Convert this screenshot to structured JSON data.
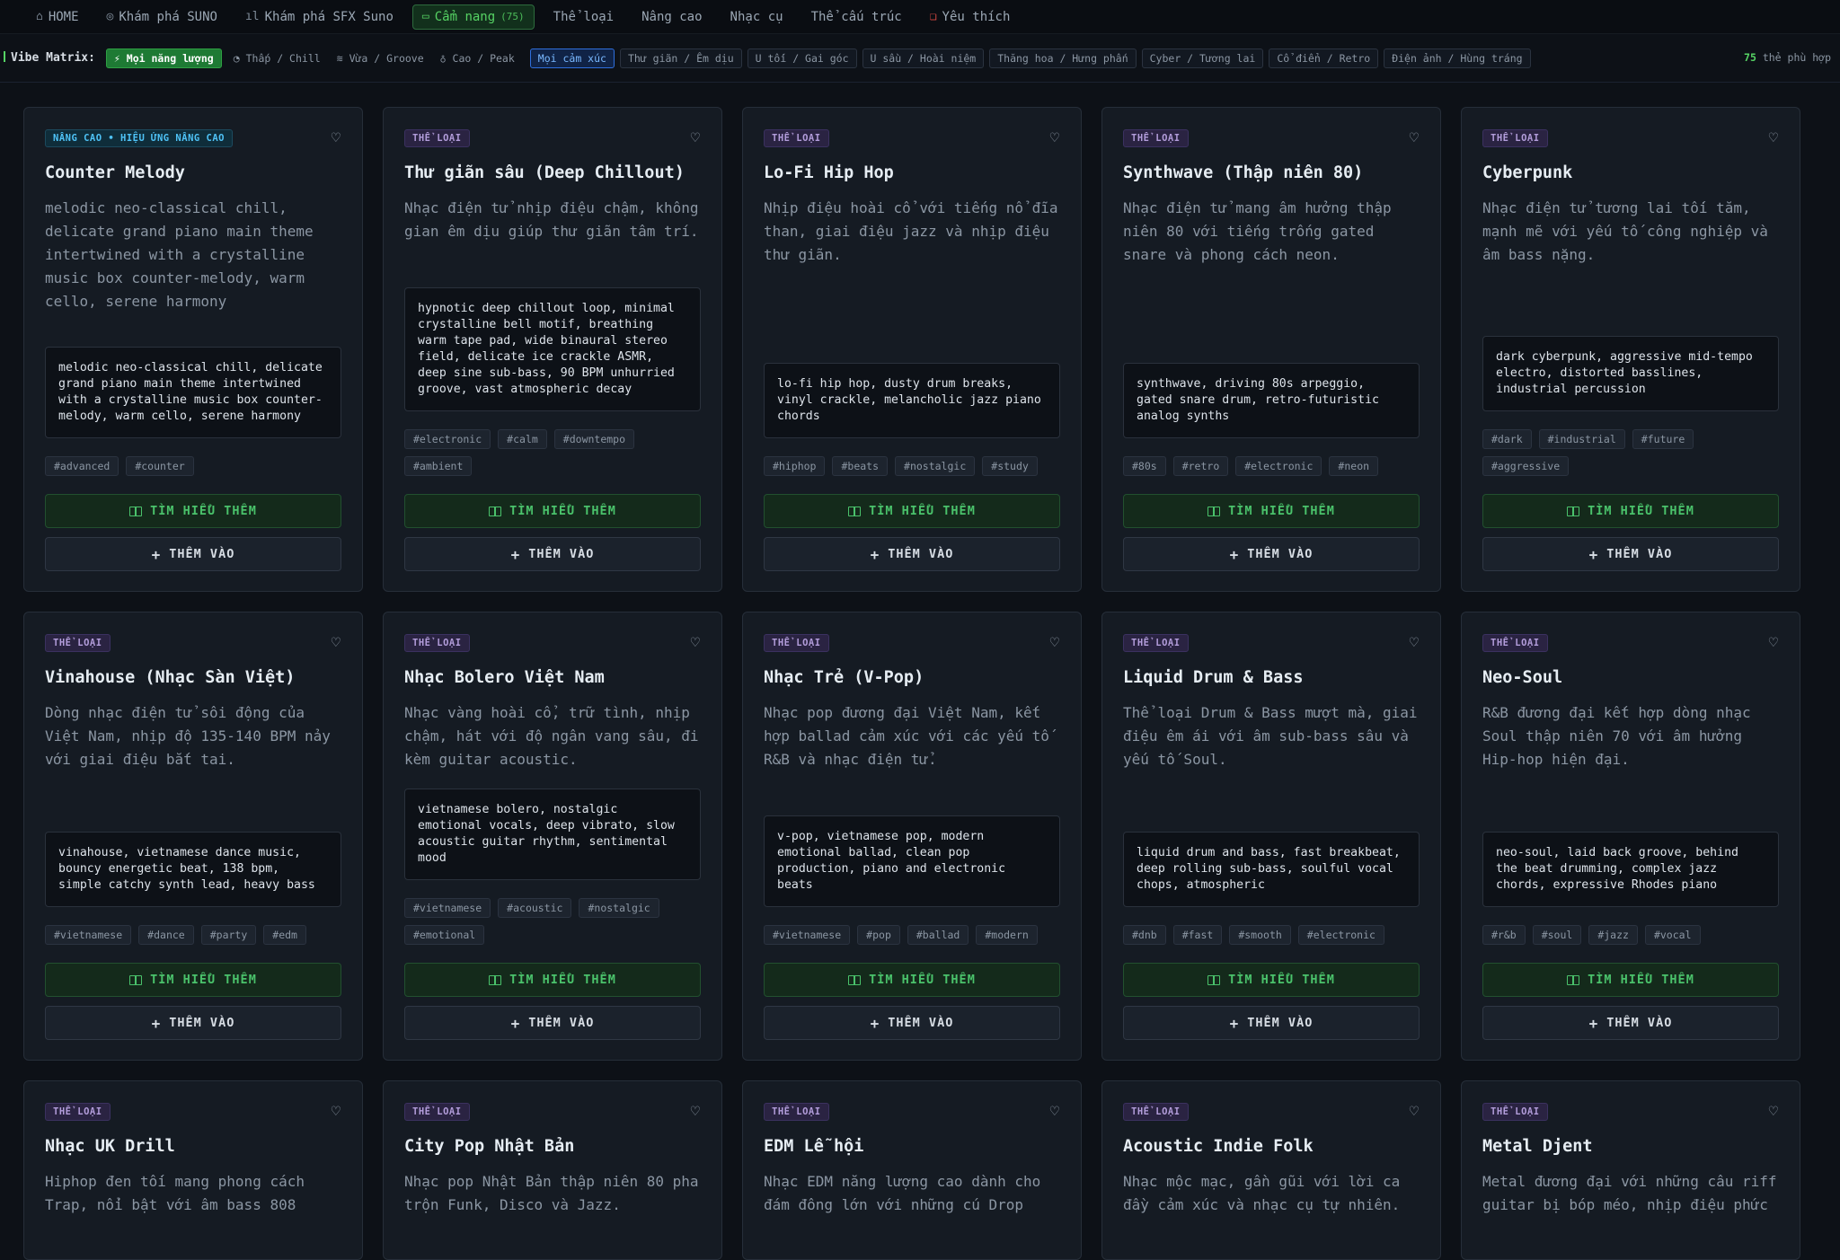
{
  "nav": {
    "items": [
      {
        "icon": "home-icon",
        "glyph": "⌂",
        "label": "HOME"
      },
      {
        "icon": "compass-icon",
        "glyph": "◎",
        "label": "Khám phá SUNO"
      },
      {
        "icon": "waveform-icon",
        "glyph": "ıl",
        "label": "Khám phá SFX Suno"
      },
      {
        "icon": "book-icon",
        "glyph": "▭",
        "label": "Cẩm nang",
        "count": "(75)",
        "active": true
      },
      {
        "label": "Thể loại"
      },
      {
        "label": "Nâng cao"
      },
      {
        "label": "Nhạc cụ"
      },
      {
        "label": "Thể cấu trúc"
      },
      {
        "icon": "bookmark-icon",
        "glyph": "❏",
        "label": "Yêu thích"
      }
    ]
  },
  "vibe": {
    "label": "Vibe Matrix:",
    "energy": {
      "active": "Mọi năng lượng",
      "options": [
        "Thấp / Chill",
        "Vừa / Groove",
        "Cao / Peak"
      ]
    },
    "mood": {
      "active": "Mọi cảm xúc",
      "options": [
        "Thư giãn / Êm dịu",
        "U tối / Gai góc",
        "U sầu / Hoài niệm",
        "Thăng hoa / Hưng phấn",
        "Cyber / Tương lai",
        "Cổ điển / Retro",
        "Điện ảnh / Hùng tráng"
      ]
    },
    "count_value": "75",
    "count_suffix": "thẻ phù hợp"
  },
  "labels": {
    "learn_more": "TÌM HIỂU THÊM",
    "add": "THÊM VÀO"
  },
  "cards": [
    {
      "badge": "NÂNG CAO • HIỆU ỨNG NÂNG CAO",
      "badge_type": "adv",
      "title": "Counter Melody",
      "desc": "melodic neo-classical chill, delicate grand piano main theme intertwined with a crystalline music box counter-melody, warm cello, serene harmony",
      "prompt": "melodic neo-classical chill, delicate grand piano main theme intertwined with a crystalline music box counter-melody, warm cello, serene harmony",
      "tags": [
        "#advanced",
        "#counter"
      ]
    },
    {
      "badge": "THỂ LOẠI",
      "title": "Thư giãn sâu (Deep Chillout)",
      "desc": "Nhạc điện tử nhịp điệu chậm, không gian êm dịu giúp thư giãn tâm trí.",
      "prompt": "hypnotic deep chillout loop, minimal crystalline bell motif, breathing warm tape pad, wide binaural stereo field, delicate ice crackle ASMR, deep sine sub-bass, 90 BPM unhurried groove, vast atmospheric decay",
      "tags": [
        "#electronic",
        "#calm",
        "#downtempo",
        "#ambient"
      ]
    },
    {
      "badge": "THỂ LOẠI",
      "title": "Lo-Fi Hip Hop",
      "desc": "Nhịp điệu hoài cổ với tiếng nổ đĩa than, giai điệu jazz và nhịp điệu thư giãn.",
      "prompt": "lo-fi hip hop, dusty drum breaks, vinyl crackle, melancholic jazz piano chords",
      "tags": [
        "#hiphop",
        "#beats",
        "#nostalgic",
        "#study"
      ]
    },
    {
      "badge": "THỂ LOẠI",
      "title": "Synthwave (Thập niên 80)",
      "desc": "Nhạc điện tử mang âm hưởng thập niên 80 với tiếng trống gated snare và phong cách neon.",
      "prompt": "synthwave, driving 80s arpeggio, gated snare drum, retro-futuristic analog synths",
      "tags": [
        "#80s",
        "#retro",
        "#electronic",
        "#neon"
      ]
    },
    {
      "badge": "THỂ LOẠI",
      "title": "Cyberpunk",
      "desc": "Nhạc điện tử tương lai tối tăm, mạnh mẽ với yếu tố công nghiệp và âm bass nặng.",
      "prompt": "dark cyberpunk, aggressive mid-tempo electro, distorted basslines, industrial percussion",
      "tags": [
        "#dark",
        "#industrial",
        "#future",
        "#aggressive"
      ]
    },
    {
      "badge": "THỂ LOẠI",
      "title": "Vinahouse (Nhạc Sàn Việt)",
      "desc": "Dòng nhạc điện tử sôi động của Việt Nam, nhịp độ 135-140 BPM nảy với giai điệu bắt tai.",
      "prompt": "vinahouse, vietnamese dance music, bouncy energetic beat, 138 bpm, simple catchy synth lead, heavy bass",
      "tags": [
        "#vietnamese",
        "#dance",
        "#party",
        "#edm"
      ]
    },
    {
      "badge": "THỂ LOẠI",
      "title": "Nhạc Bolero Việt Nam",
      "desc": "Nhạc vàng hoài cổ, trữ tình, nhịp chậm, hát với độ ngân vang sâu, đi kèm guitar acoustic.",
      "prompt": "vietnamese bolero, nostalgic emotional vocals, deep vibrato, slow acoustic guitar rhythm, sentimental mood",
      "tags": [
        "#vietnamese",
        "#acoustic",
        "#nostalgic",
        "#emotional"
      ]
    },
    {
      "badge": "THỂ LOẠI",
      "title": "Nhạc Trẻ (V-Pop)",
      "desc": "Nhạc pop đương đại Việt Nam, kết hợp ballad cảm xúc với các yếu tố R&B và nhạc điện tử.",
      "prompt": "v-pop, vietnamese pop, modern emotional ballad, clean pop production, piano and electronic beats",
      "tags": [
        "#vietnamese",
        "#pop",
        "#ballad",
        "#modern"
      ]
    },
    {
      "badge": "THỂ LOẠI",
      "title": "Liquid Drum & Bass",
      "desc": "Thể loại Drum & Bass mượt mà, giai điệu êm ái với âm sub-bass sâu và yếu tố Soul.",
      "prompt": "liquid drum and bass, fast breakbeat, deep rolling sub-bass, soulful vocal chops, atmospheric",
      "tags": [
        "#dnb",
        "#fast",
        "#smooth",
        "#electronic"
      ]
    },
    {
      "badge": "THỂ LOẠI",
      "title": "Neo-Soul",
      "desc": "R&B đương đại kết hợp dòng nhạc Soul thập niên 70 với âm hưởng Hip-hop hiện đại.",
      "prompt": "neo-soul, laid back groove, behind the beat drumming, complex jazz chords, expressive Rhodes piano",
      "tags": [
        "#r&b",
        "#soul",
        "#jazz",
        "#vocal"
      ]
    },
    {
      "badge": "THỂ LOẠI",
      "title": "Nhạc UK Drill",
      "desc": "Hiphop đen tối mang phong cách Trap, nổi bật với âm bass 808"
    },
    {
      "badge": "THỂ LOẠI",
      "title": "City Pop Nhật Bản",
      "desc": "Nhạc pop Nhật Bản thập niên 80 pha trộn Funk, Disco và Jazz."
    },
    {
      "badge": "THỂ LOẠI",
      "title": "EDM Lễ hội",
      "desc": "Nhạc EDM năng lượng cao dành cho đám đông lớn với những cú Drop"
    },
    {
      "badge": "THỂ LOẠI",
      "title": "Acoustic Indie Folk",
      "desc": "Nhạc mộc mạc, gần gũi với lời ca đầy cảm xúc và nhạc cụ tự nhiên."
    },
    {
      "badge": "THỂ LOẠI",
      "title": "Metal Djent",
      "desc": "Metal đương đại với những câu riff guitar bị bóp méo, nhịp điệu phức"
    }
  ]
}
